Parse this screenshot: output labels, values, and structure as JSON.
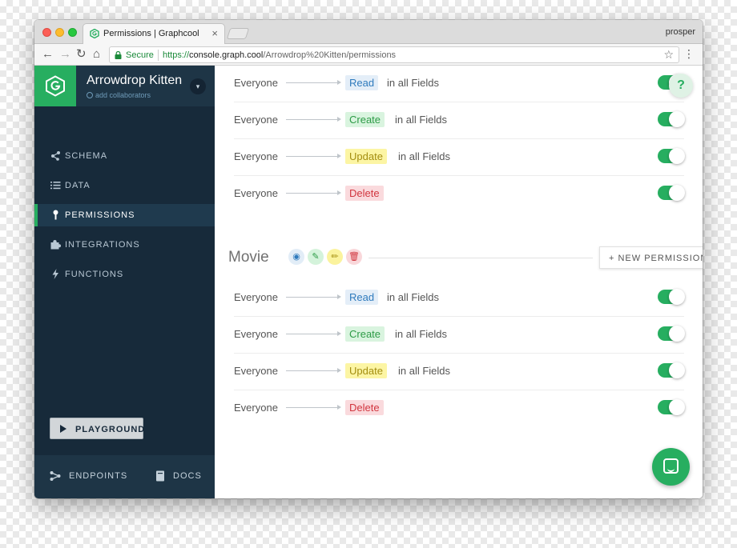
{
  "browser": {
    "tab_title": "Permissions | Graphcool",
    "tab_close": "×",
    "profile_name": "prosper",
    "secure_label": "Secure",
    "url_scheme": "https://",
    "url_host": "console.graph.cool",
    "url_path": "/Arrowdrop%20Kitten/permissions",
    "back": "←",
    "forward": "→",
    "reload": "↻",
    "home": "⌂",
    "star": "☆",
    "menu": "⋮"
  },
  "sidebar": {
    "project_name": "Arrowdrop Kitten",
    "add_collaborators": "add collaborators",
    "toggle_glyph": "▾",
    "items": [
      {
        "label": "SCHEMA",
        "icon": "schema-icon"
      },
      {
        "label": "DATA",
        "icon": "list-icon"
      },
      {
        "label": "PERMISSIONS",
        "icon": "key-icon",
        "active": true
      },
      {
        "label": "INTEGRATIONS",
        "icon": "puzzle-icon"
      },
      {
        "label": "FUNCTIONS",
        "icon": "lightning-icon"
      }
    ],
    "playground_label": "PLAYGROUND",
    "footer": {
      "endpoints_label": "ENDPOINTS",
      "docs_label": "DOCS"
    }
  },
  "main": {
    "first_group": [
      {
        "who": "Everyone",
        "op": "Read",
        "scope": "in all Fields"
      },
      {
        "who": "Everyone",
        "op": "Create",
        "scope": "in all Fields"
      },
      {
        "who": "Everyone",
        "op": "Update",
        "scope": "in all Fields"
      },
      {
        "who": "Everyone",
        "op": "Delete",
        "scope": ""
      }
    ],
    "model": {
      "name": "Movie",
      "new_permission_label": "+ NEW PERMISSION",
      "icons": {
        "read": "◉",
        "create": "✎",
        "update": "✏",
        "delete": "🗑"
      }
    },
    "movie_group": [
      {
        "who": "Everyone",
        "op": "Read",
        "scope": "in all Fields"
      },
      {
        "who": "Everyone",
        "op": "Create",
        "scope": "in all Fields"
      },
      {
        "who": "Everyone",
        "op": "Update",
        "scope": "in all Fields"
      },
      {
        "who": "Everyone",
        "op": "Delete",
        "scope": ""
      }
    ],
    "help_label": "?"
  },
  "colors": {
    "accent_green": "#27ae60",
    "sidebar_bg": "#172a3a",
    "read": "#2f7bbd",
    "create": "#2d9b46",
    "update": "#a48e10",
    "delete": "#d1363f"
  }
}
